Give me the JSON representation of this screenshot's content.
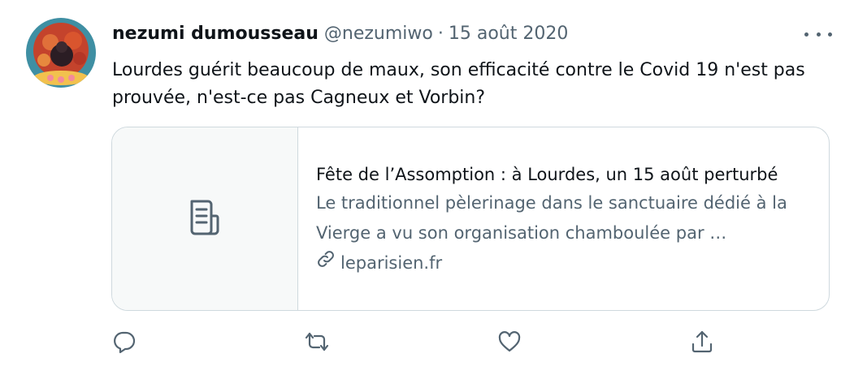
{
  "tweet": {
    "display_name": "nezumi dumousseau",
    "handle": "@nezumiwo",
    "separator": "·",
    "date": "15 août 2020",
    "text": "Lourdes guérit beaucoup de maux, son efficacité contre le Covid 19 n'est pas prouvée, n'est-ce pas Cagneux et Vorbin?"
  },
  "card": {
    "title": "Fête de l’Assomption : à Lourdes, un 15 août perturbé",
    "description": "Le traditionnel pèlerinage dans le sanctuaire dédié à la Vierge a vu son organisation chamboulée par …",
    "domain": "leparisien.fr",
    "thumbnail_icon": "article-icon",
    "link_icon": "link-icon"
  },
  "actions": [
    {
      "name": "reply",
      "icon": "reply-icon"
    },
    {
      "name": "retweet",
      "icon": "retweet-icon"
    },
    {
      "name": "like",
      "icon": "heart-icon"
    },
    {
      "name": "share",
      "icon": "share-icon"
    }
  ],
  "colors": {
    "text_primary": "#0f1419",
    "text_secondary": "#536471",
    "border": "#cfd9de",
    "thumb_bg": "#f7f9f9"
  }
}
